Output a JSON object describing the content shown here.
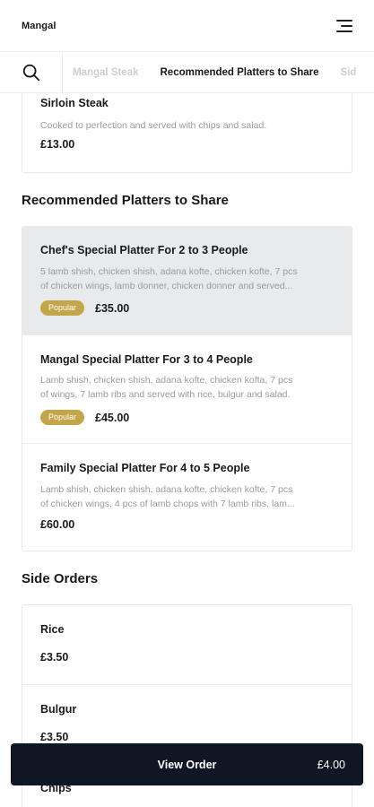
{
  "header": {
    "brand": "Mangal",
    "menu_icon": "hamburger-menu-icon"
  },
  "categories": {
    "search_icon": "search-icon",
    "tabs": [
      {
        "label": "Mangal Steak",
        "active": false
      },
      {
        "label": "Recommended Platters to Share",
        "active": true
      },
      {
        "label": "Sid",
        "active": false
      }
    ]
  },
  "steak_item": {
    "name": "Sirloin Steak",
    "description": "Cooked to perfection and served with chips and salad.",
    "price": "£13.00"
  },
  "platters": {
    "title": "Recommended Platters to Share",
    "items": [
      {
        "name": "Chef's Special Platter For 2 to 3 People",
        "description_line1": "5 lamb shish, chicken shish, adana kofte, chicken kofte, 7 pcs",
        "description_line2": "of chicken wings, lamb donner, chicken donner and served...",
        "badge": "Popular",
        "price": "£35.00"
      },
      {
        "name": "Mangal Special Platter For 3 to 4 People",
        "description_line1": "Lamb shish, chicken shish, adana kofte, chicken kofta, 7 pcs",
        "description_line2": "of wings, 7 lamb ribs and served with rice, bulgur and salad.",
        "badge": "Popular",
        "price": "£45.00"
      },
      {
        "name": "Family Special Platter For 4 to 5 People",
        "description_line1": "Lamb shish, chicken shish, adana kofte, chicken kofte, 7 pcs",
        "description_line2": "of chicken wings, 4 pcs of lamb chops with 7 lamb ribs, lam...",
        "price": "£60.00"
      }
    ]
  },
  "side_orders": {
    "title": "Side Orders",
    "items": [
      {
        "name": "Rice",
        "price": "£3.50"
      },
      {
        "name": "Bulgur",
        "price": "£3.50"
      },
      {
        "name": "Chips"
      }
    ]
  },
  "order_bar": {
    "label": "View Order",
    "total": "£4.00"
  },
  "colors": {
    "badge": "#c4a64a",
    "order_bar": "#0f1724",
    "highlight": "#e9eaec"
  }
}
